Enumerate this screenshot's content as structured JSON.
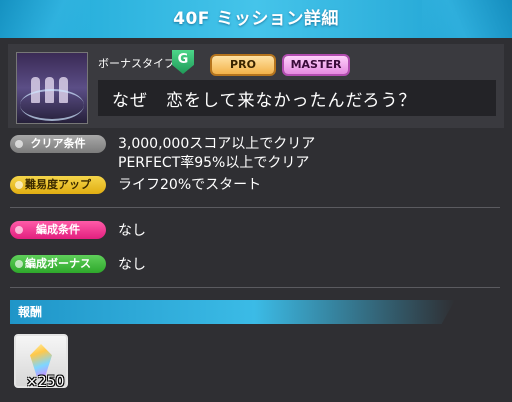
{
  "header": {
    "title": "40F ミッション詳細"
  },
  "song": {
    "bonus_type_label": "ボーナスタイプ",
    "bonus_badge": "G",
    "difficulties": [
      "PRO",
      "MASTER"
    ],
    "title": "なぜ　恋をして来なかったんだろう？"
  },
  "conditions": {
    "clear": {
      "label": "クリア条件",
      "lines": [
        "3,000,000スコア以上でクリア",
        "PERFECT率95%以上でクリア"
      ]
    },
    "difficulty_up": {
      "label": "難易度アップ",
      "value": "ライフ20%でスタート"
    },
    "formation": {
      "label": "編成条件",
      "value": "なし"
    },
    "formation_bonus": {
      "label": "編成ボーナス",
      "value": "なし"
    }
  },
  "reward": {
    "title": "報酬",
    "item_icon": "crystal-icon",
    "count": "×250"
  },
  "colors": {
    "header": "#2cb5e2",
    "pill_gray": "#8f8f8f",
    "pill_yellow": "#efc22a",
    "pill_pink": "#f2388f",
    "pill_green": "#41b83c",
    "pro": "#f3b24a",
    "master": "#e58ae0"
  }
}
